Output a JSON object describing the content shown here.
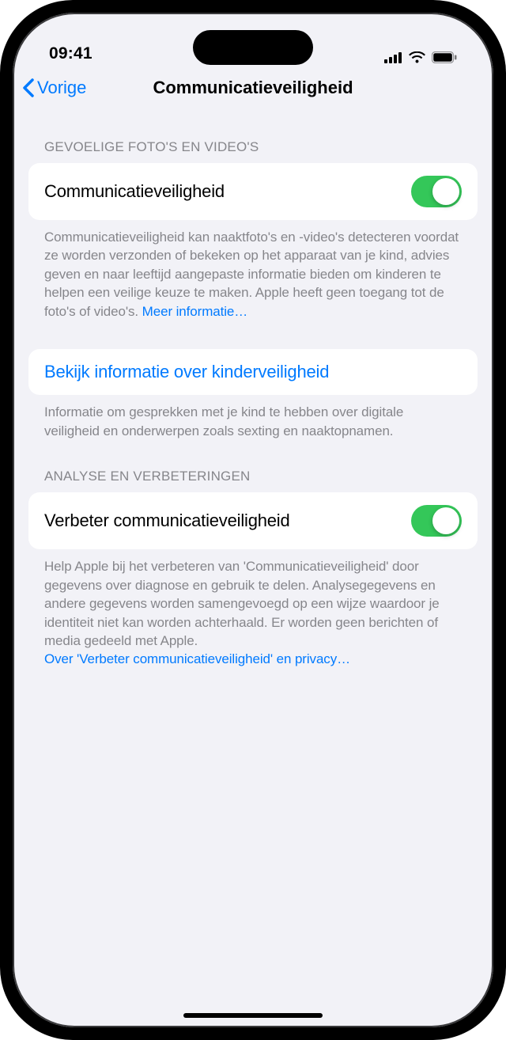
{
  "status": {
    "time": "09:41"
  },
  "nav": {
    "back_label": "Vorige",
    "title": "Communicatieveiligheid"
  },
  "section1": {
    "header": "Gevoelige foto's en video's",
    "row_label": "Communicatieveiligheid",
    "footer_text": "Communicatieveiligheid kan naaktfoto's en -video's detecteren voordat ze worden verzonden of bekeken op het apparaat van je kind, advies geven en naar leeftijd aangepaste informatie bieden om kinderen te helpen een veilige keuze te maken. Apple heeft geen toegang tot de foto's of video's. ",
    "footer_link": "Meer informatie…"
  },
  "link_row": {
    "label": "Bekijk informatie over kinderveiligheid",
    "footer": "Informatie om gesprekken met je kind te hebben over digitale veiligheid en onderwerpen zoals sexting en naaktopnamen."
  },
  "section2": {
    "header": "Analyse en verbeteringen",
    "row_label": "Verbeter communicatieveiligheid",
    "footer_text": "Help Apple bij het verbeteren van 'Communicatieveiligheid' door gegevens over diagnose en gebruik te delen. Analysegegevens en andere gegevens worden samengevoegd op een wijze waardoor je identiteit niet kan worden achterhaald. Er worden geen berichten of media gedeeld met Apple. ",
    "footer_link": "Over 'Verbeter communicatieveiligheid' en privacy…"
  }
}
